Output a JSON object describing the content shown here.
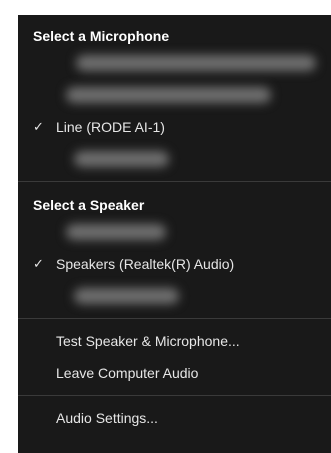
{
  "microphone": {
    "header": "Select a Microphone",
    "selected_item": "Line (RODE AI-1)"
  },
  "speaker": {
    "header": "Select a Speaker",
    "selected_item": "Speakers (Realtek(R) Audio)"
  },
  "actions": {
    "test_speaker_mic": "Test Speaker & Microphone...",
    "leave_computer_audio": "Leave Computer Audio"
  },
  "settings": {
    "audio_settings": "Audio Settings..."
  },
  "icons": {
    "check": "check-icon"
  },
  "colors": {
    "menu_background": "#191919",
    "text": "#e6e6e6",
    "divider": "#3a3a3a"
  }
}
